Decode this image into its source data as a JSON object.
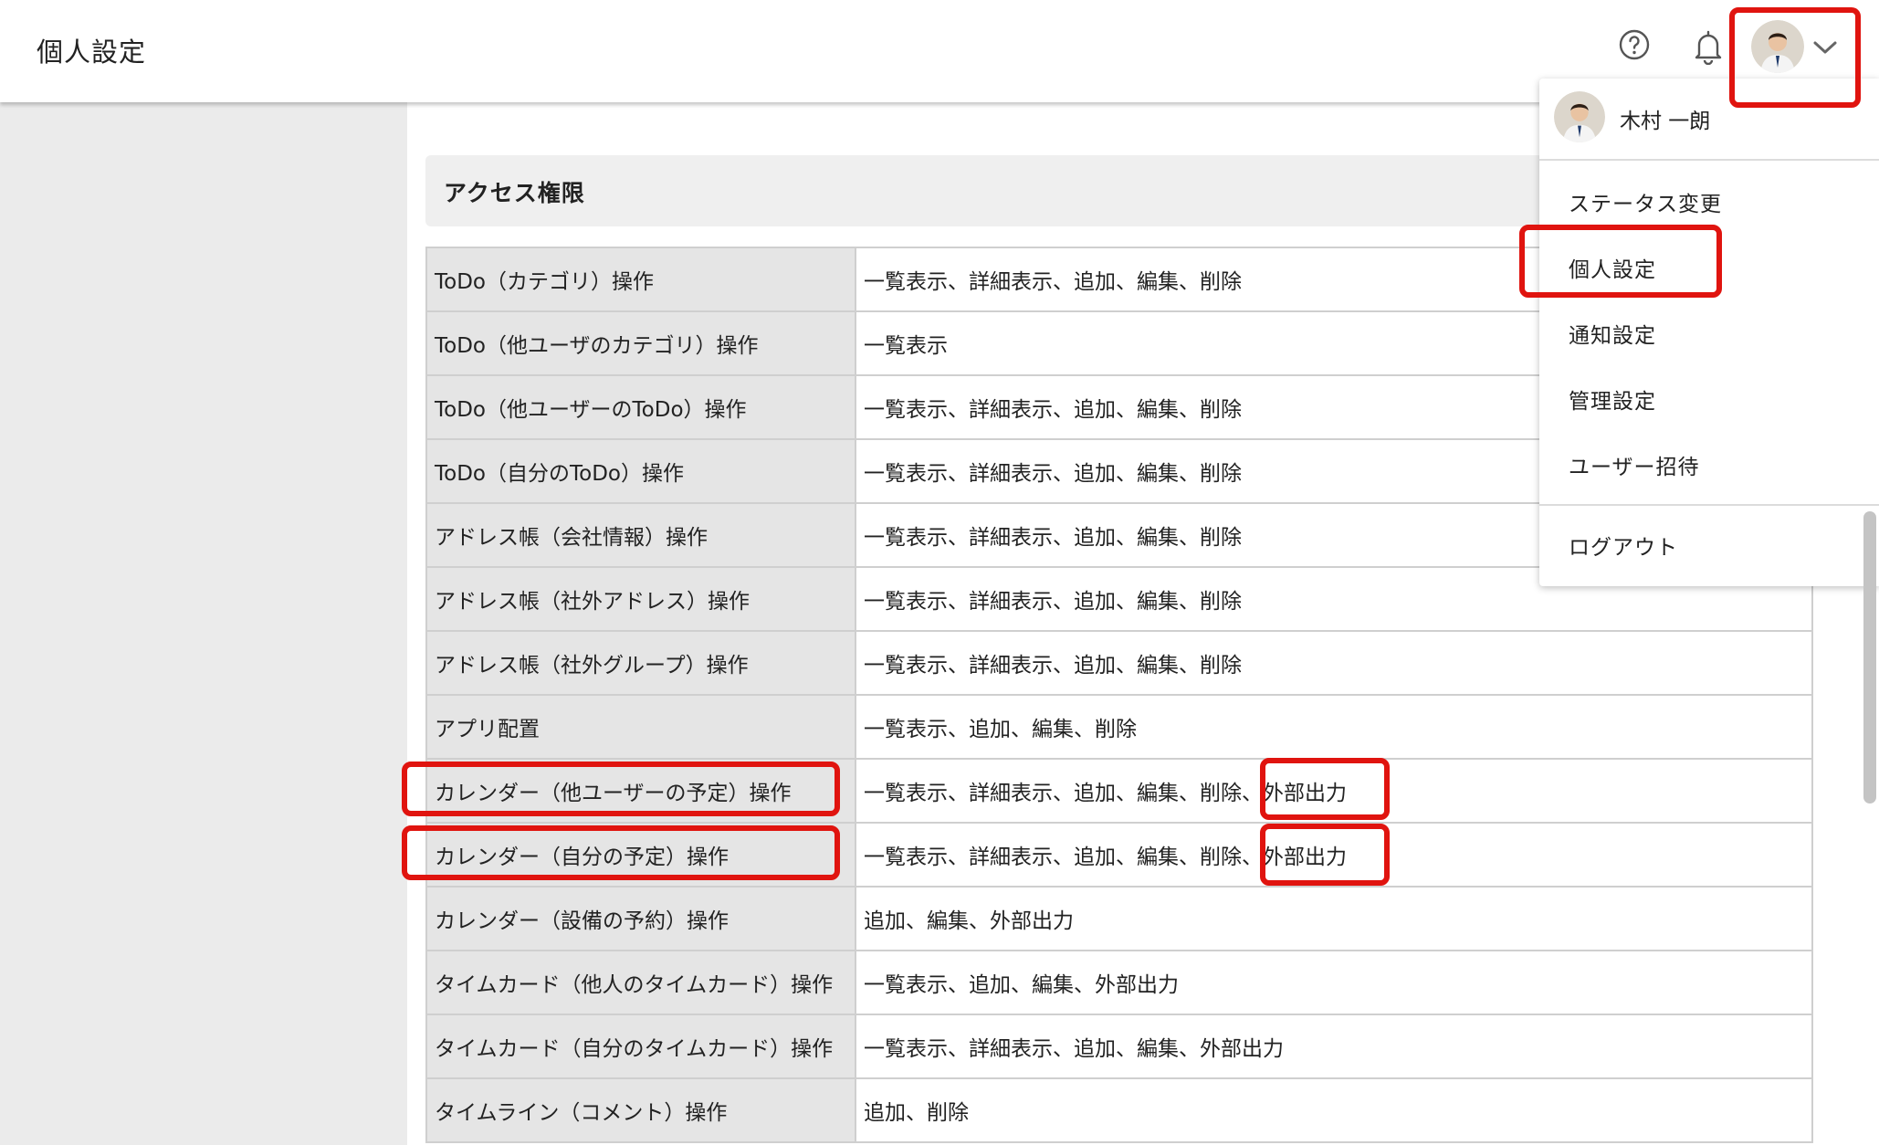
{
  "header": {
    "title": "個人設定",
    "help_icon": "help-circle-icon",
    "bell_icon": "bell-icon",
    "chevron_icon": "chevron-down-icon"
  },
  "section": {
    "title": "アクセス権限"
  },
  "permissions": [
    {
      "label": "ToDo（カテゴリ）操作",
      "value": "一覧表示、詳細表示、追加、編集、削除"
    },
    {
      "label": "ToDo（他ユーザのカテゴリ）操作",
      "value": "一覧表示"
    },
    {
      "label": "ToDo（他ユーザーのToDo）操作",
      "value": "一覧表示、詳細表示、追加、編集、削除"
    },
    {
      "label": "ToDo（自分のToDo）操作",
      "value": "一覧表示、詳細表示、追加、編集、削除"
    },
    {
      "label": "アドレス帳（会社情報）操作",
      "value": "一覧表示、詳細表示、追加、編集、削除"
    },
    {
      "label": "アドレス帳（社外アドレス）操作",
      "value": "一覧表示、詳細表示、追加、編集、削除"
    },
    {
      "label": "アドレス帳（社外グループ）操作",
      "value": "一覧表示、詳細表示、追加、編集、削除"
    },
    {
      "label": "アプリ配置",
      "value": "一覧表示、追加、編集、削除"
    },
    {
      "label": "カレンダー（他ユーザーの予定）操作",
      "value": "一覧表示、詳細表示、追加、編集、削除、外部出力"
    },
    {
      "label": "カレンダー（自分の予定）操作",
      "value": "一覧表示、詳細表示、追加、編集、削除、外部出力"
    },
    {
      "label": "カレンダー（設備の予約）操作",
      "value": "追加、編集、外部出力"
    },
    {
      "label": "タイムカード（他人のタイムカード）操作",
      "value": "一覧表示、追加、編集、外部出力"
    },
    {
      "label": "タイムカード（自分のタイムカード）操作",
      "value": "一覧表示、詳細表示、追加、編集、外部出力"
    },
    {
      "label": "タイムライン（コメント）操作",
      "value": "追加、削除"
    }
  ],
  "user_menu": {
    "username": "木村 一朗",
    "items": [
      "ステータス変更",
      "個人設定",
      "通知設定",
      "管理設定",
      "ユーザー招待"
    ],
    "logout": "ログアウト"
  },
  "colors": {
    "highlight": "#e0140f",
    "label_cell_bg": "#e5e5e5",
    "page_bg": "#ebebeb"
  }
}
